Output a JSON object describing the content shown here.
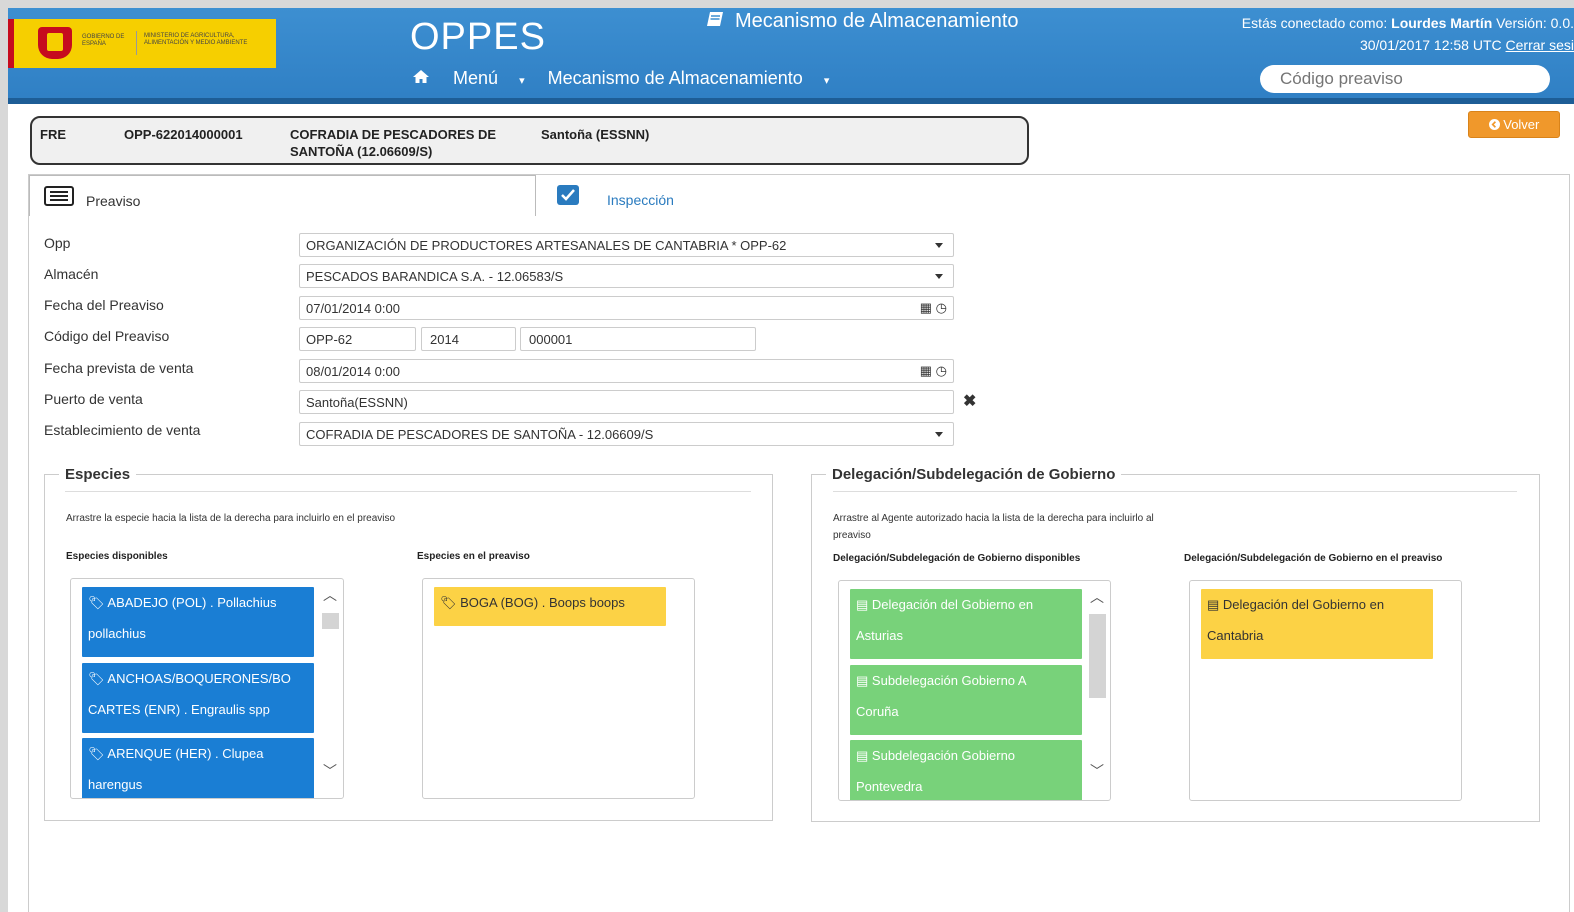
{
  "header": {
    "logo": {
      "gobierno": "GOBIERNO DE ESPAÑA",
      "ministerio": "MINISTERIO DE AGRICULTURA, ALIMENTACIÓN Y MEDIO AMBIENTE"
    },
    "app_title": "OPPES",
    "section_title": "Mecanismo de Almacenamiento",
    "user_prefix": "Estás conectado como:",
    "user_name": "Lourdes Martín",
    "version_label": "Versión: 0.0.",
    "datetime": "30/01/2017 12:58",
    "timezone": "UTC",
    "logout": "Cerrar sesi",
    "nav": {
      "menu": "Menú",
      "mecanismo": "Mecanismo de Almacenamiento"
    },
    "search_placeholder": "Código preaviso"
  },
  "infobar": {
    "type": "FRE",
    "code": "OPP-622014000001",
    "entity_line1": "COFRADIA DE PESCADORES DE",
    "entity_line2": "SANTOÑA (12.06609/S)",
    "port": "Santoña (ESSNN)"
  },
  "volver_label": "Volver",
  "tabs": {
    "preaviso": "Preaviso",
    "inspeccion": "Inspección"
  },
  "form": {
    "opp_label": "Opp",
    "opp_value": "ORGANIZACIÓN DE PRODUCTORES ARTESANALES DE CANTABRIA * OPP-62",
    "almacen_label": "Almacén",
    "almacen_value": "PESCADOS BARANDICA S.A. - 12.06583/S",
    "fecha_preaviso_label": "Fecha del Preaviso",
    "fecha_preaviso_value": "07/01/2014 0:00",
    "codigo_label": "Código del Preaviso",
    "codigo_1": "OPP-62",
    "codigo_2": "2014",
    "codigo_3": "000001",
    "fecha_venta_label": "Fecha prevista de venta",
    "fecha_venta_value": "08/01/2014 0:00",
    "puerto_label": "Puerto de venta",
    "puerto_value": "Santoña(ESSNN)",
    "establecimiento_label": "Establecimiento de venta",
    "establecimiento_value": "COFRADIA DE PESCADORES DE SANTOÑA - 12.06609/S"
  },
  "especies": {
    "title": "Especies",
    "hint": "Arrastre la especie hacia la lista de la derecha para incluirlo en el preaviso",
    "disponibles_label": "Especies disponibles",
    "preaviso_label": "Especies en el preaviso",
    "disponibles": [
      {
        "line1": "ABADEJO (POL) . Pollachius",
        "line2": "pollachius"
      },
      {
        "line1": "ANCHOAS/BOQUERONES/BO",
        "line2": "CARTES (ENR) . Engraulis spp"
      },
      {
        "line1": "ARENQUE (HER) . Clupea",
        "line2": "harengus"
      }
    ],
    "seleccionadas": [
      {
        "line1": "BOGA (BOG) . Boops boops"
      }
    ]
  },
  "delegacion": {
    "title": "Delegación/Subdelegación de Gobierno",
    "hint_line1": "Arrastre al Agente autorizado hacia la lista de la derecha para incluirlo al",
    "hint_line2": "preaviso",
    "disponibles_label": "Delegación/Subdelegación de Gobierno disponibles",
    "preaviso_label": "Delegación/Subdelegación de Gobierno en el preaviso",
    "disponibles": [
      {
        "line1": "Delegación del Gobierno en",
        "line2": "Asturias"
      },
      {
        "line1": "Subdelegación Gobierno A",
        "line2": "Coruña"
      },
      {
        "line1": "Subdelegación Gobierno",
        "line2": "Pontevedra"
      }
    ],
    "seleccionadas": [
      {
        "line1": "Delegación del Gobierno en",
        "line2": "Cantabria"
      }
    ]
  },
  "colors": {
    "header_blue": "#3d8fd1",
    "species_blue": "#1a7ed4",
    "selected_yellow": "#fcd245",
    "delegation_green": "#78d27a",
    "volver_orange": "#f0982b"
  }
}
